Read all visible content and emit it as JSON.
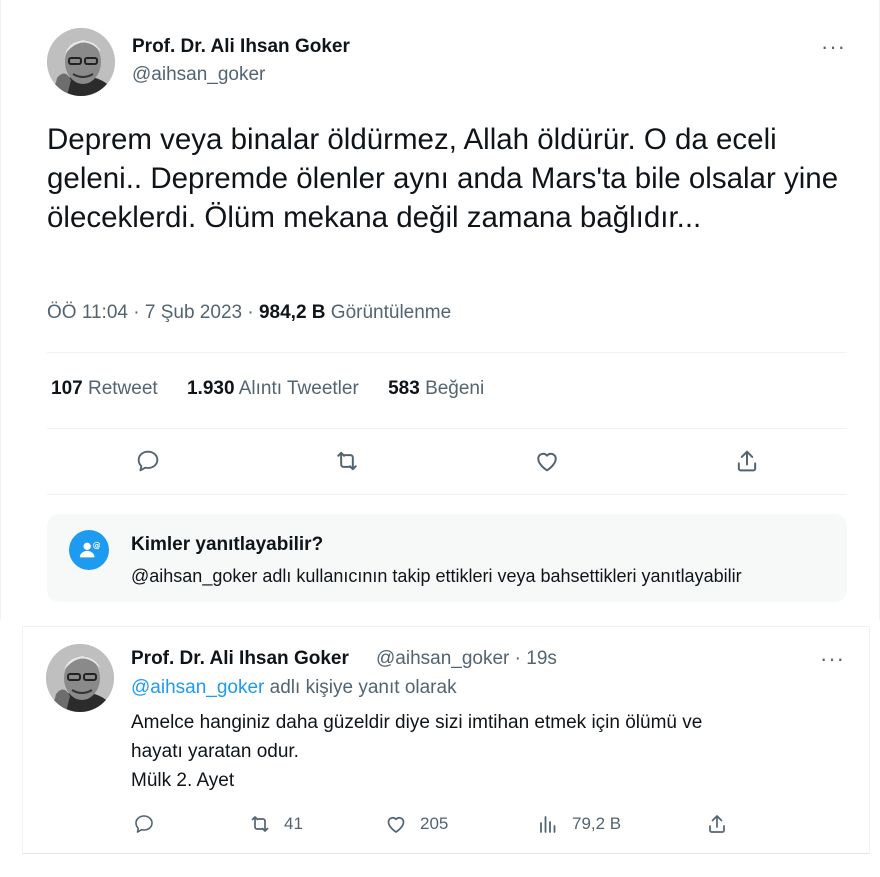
{
  "main_tweet": {
    "author_name": "Prof. Dr. Ali Ihsan Goker",
    "author_handle": "@aihsan_goker",
    "more_label": "···",
    "text": "Deprem veya binalar öldürmez, Allah öldürür. O da eceli geleni.. Depremde ölenler aynı anda Mars'ta bile olsalar yine öleceklerdi. Ölüm mekana değil zamana bağlıdır...",
    "time": "ÖÖ 11:04",
    "date": "7 Şub 2023",
    "views_count": "984,2 B",
    "views_label": "Görüntülenme",
    "separator": "·"
  },
  "stats": {
    "retweets_count": "107",
    "retweets_label": "Retweet",
    "quotes_count": "1.930",
    "quotes_label": "Alıntı Tweetler",
    "likes_count": "583",
    "likes_label": "Beğeni"
  },
  "reply_restriction": {
    "title": "Kimler yanıtlayabilir?",
    "description": "@aihsan_goker adlı kullanıcının takip ettikleri veya bahsettikleri yanıtlayabilir"
  },
  "reply_tweet": {
    "author_name": "Prof. Dr. Ali Ihsan Goker",
    "author_handle": "@aihsan_goker",
    "separator": "·",
    "time_ago": "19s",
    "more_label": "···",
    "reply_to_handle": "@aihsan_goker",
    "reply_to_suffix": "adlı kişiye yanıt olarak",
    "text_line1": "Amelce hanginiz daha güzeldir diye sizi imtihan etmek için ölümü ve",
    "text_line2": "hayatı yaratan odur.",
    "text_line3": "Mülk 2. Ayet",
    "retweets": "41",
    "likes": "205",
    "views": "79,2 B"
  },
  "colors": {
    "accent": "#1d9bf0",
    "text": "#0f1419",
    "secondary": "#536471",
    "divider": "#eff3f4",
    "info_box": "#f7f9f9"
  }
}
